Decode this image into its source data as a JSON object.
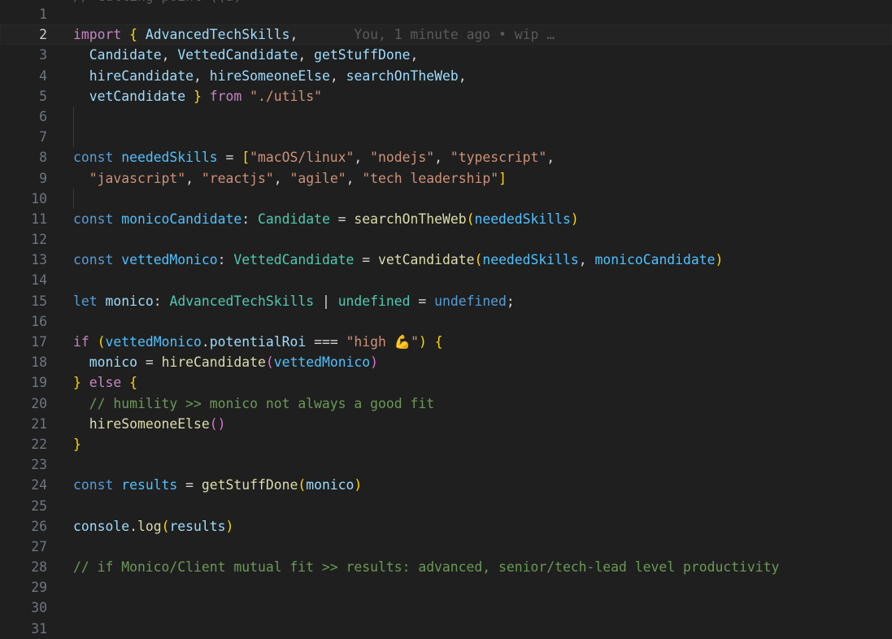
{
  "editor": {
    "top_cutoff_text": "// Cutting point ((a)",
    "blame": "You, 1 minute ago • wip …",
    "lines": [
      {
        "n": "1",
        "tokens": []
      },
      {
        "n": "2",
        "current": true,
        "tokens": [
          [
            "kc",
            "import"
          ],
          [
            "p",
            " "
          ],
          [
            "b1",
            "{"
          ],
          [
            "p",
            " "
          ],
          [
            "v",
            "AdvancedTechSkills"
          ],
          [
            "p",
            ","
          ]
        ],
        "blame": true
      },
      {
        "n": "3",
        "tokens": [
          [
            "p",
            "  "
          ],
          [
            "v",
            "Candidate"
          ],
          [
            "p",
            ", "
          ],
          [
            "v",
            "VettedCandidate"
          ],
          [
            "p",
            ", "
          ],
          [
            "v",
            "getStuffDone"
          ],
          [
            "p",
            ","
          ]
        ]
      },
      {
        "n": "4",
        "tokens": [
          [
            "p",
            "  "
          ],
          [
            "v",
            "hireCandidate"
          ],
          [
            "p",
            ", "
          ],
          [
            "v",
            "hireSomeoneElse"
          ],
          [
            "p",
            ", "
          ],
          [
            "v",
            "searchOnTheWeb"
          ],
          [
            "p",
            ","
          ]
        ]
      },
      {
        "n": "5",
        "tokens": [
          [
            "p",
            "  "
          ],
          [
            "v",
            "vetCandidate"
          ],
          [
            "p",
            " "
          ],
          [
            "b1",
            "}"
          ],
          [
            "p",
            " "
          ],
          [
            "kc",
            "from"
          ],
          [
            "p",
            " "
          ],
          [
            "s",
            "\"./utils\""
          ]
        ]
      },
      {
        "n": "6",
        "tokens": [],
        "guide": true
      },
      {
        "n": "7",
        "tokens": [],
        "guide": true
      },
      {
        "n": "8",
        "tokens": [
          [
            "k",
            "const"
          ],
          [
            "p",
            " "
          ],
          [
            "cv",
            "neededSkills"
          ],
          [
            "p",
            " = "
          ],
          [
            "b1",
            "["
          ],
          [
            "s",
            "\"macOS/linux\""
          ],
          [
            "p",
            ", "
          ],
          [
            "s",
            "\"nodejs\""
          ],
          [
            "p",
            ", "
          ],
          [
            "s",
            "\"typescript\""
          ],
          [
            "p",
            ","
          ]
        ]
      },
      {
        "n": "9",
        "tokens": [
          [
            "p",
            "  "
          ],
          [
            "s",
            "\"javascript\""
          ],
          [
            "p",
            ", "
          ],
          [
            "s",
            "\"reactjs\""
          ],
          [
            "p",
            ", "
          ],
          [
            "s",
            "\"agile\""
          ],
          [
            "p",
            ", "
          ],
          [
            "s",
            "\"tech leadership\""
          ],
          [
            "b1",
            "]"
          ]
        ]
      },
      {
        "n": "10",
        "tokens": [],
        "guide": true
      },
      {
        "n": "11",
        "tokens": [
          [
            "k",
            "const"
          ],
          [
            "p",
            " "
          ],
          [
            "cv",
            "monicoCandidate"
          ],
          [
            "p",
            ": "
          ],
          [
            "t",
            "Candidate"
          ],
          [
            "p",
            " = "
          ],
          [
            "f",
            "searchOnTheWeb"
          ],
          [
            "b1",
            "("
          ],
          [
            "cv",
            "neededSkills"
          ],
          [
            "b1",
            ")"
          ]
        ]
      },
      {
        "n": "12",
        "tokens": []
      },
      {
        "n": "13",
        "tokens": [
          [
            "k",
            "const"
          ],
          [
            "p",
            " "
          ],
          [
            "cv",
            "vettedMonico"
          ],
          [
            "p",
            ": "
          ],
          [
            "t",
            "VettedCandidate"
          ],
          [
            "p",
            " = "
          ],
          [
            "f",
            "vetCandidate"
          ],
          [
            "b1",
            "("
          ],
          [
            "cv",
            "neededSkills"
          ],
          [
            "p",
            ", "
          ],
          [
            "cv",
            "monicoCandidate"
          ],
          [
            "b1",
            ")"
          ]
        ]
      },
      {
        "n": "14",
        "tokens": []
      },
      {
        "n": "15",
        "tokens": [
          [
            "k",
            "let"
          ],
          [
            "p",
            " "
          ],
          [
            "v",
            "monico"
          ],
          [
            "p",
            ": "
          ],
          [
            "t",
            "AdvancedTechSkills"
          ],
          [
            "p",
            " | "
          ],
          [
            "t",
            "undefined"
          ],
          [
            "p",
            " = "
          ],
          [
            "k",
            "undefined"
          ],
          [
            "p",
            ";"
          ]
        ]
      },
      {
        "n": "16",
        "tokens": []
      },
      {
        "n": "17",
        "tokens": [
          [
            "kc",
            "if"
          ],
          [
            "p",
            " "
          ],
          [
            "b1",
            "("
          ],
          [
            "cv",
            "vettedMonico"
          ],
          [
            "p",
            "."
          ],
          [
            "v",
            "potentialRoi"
          ],
          [
            "p",
            " === "
          ],
          [
            "s",
            "\"high 💪\""
          ],
          [
            "b1",
            ")"
          ],
          [
            "p",
            " "
          ],
          [
            "b1",
            "{"
          ]
        ]
      },
      {
        "n": "18",
        "tokens": [
          [
            "p",
            "  "
          ],
          [
            "v",
            "monico"
          ],
          [
            "p",
            " = "
          ],
          [
            "f",
            "hireCandidate"
          ],
          [
            "b2",
            "("
          ],
          [
            "cv",
            "vettedMonico"
          ],
          [
            "b2",
            ")"
          ]
        ]
      },
      {
        "n": "19",
        "tokens": [
          [
            "b1",
            "}"
          ],
          [
            "p",
            " "
          ],
          [
            "kc",
            "else"
          ],
          [
            "p",
            " "
          ],
          [
            "b1",
            "{"
          ]
        ]
      },
      {
        "n": "20",
        "tokens": [
          [
            "p",
            "  "
          ],
          [
            "c",
            "// humility >> monico not always a good fit"
          ]
        ]
      },
      {
        "n": "21",
        "tokens": [
          [
            "p",
            "  "
          ],
          [
            "f",
            "hireSomeoneElse"
          ],
          [
            "b2",
            "()"
          ]
        ]
      },
      {
        "n": "22",
        "tokens": [
          [
            "b1",
            "}"
          ]
        ]
      },
      {
        "n": "23",
        "tokens": []
      },
      {
        "n": "24",
        "tokens": [
          [
            "k",
            "const"
          ],
          [
            "p",
            " "
          ],
          [
            "cv",
            "results"
          ],
          [
            "p",
            " = "
          ],
          [
            "f",
            "getStuffDone"
          ],
          [
            "b1",
            "("
          ],
          [
            "v",
            "monico"
          ],
          [
            "b1",
            ")"
          ]
        ]
      },
      {
        "n": "25",
        "tokens": []
      },
      {
        "n": "26",
        "tokens": [
          [
            "v",
            "console"
          ],
          [
            "p",
            "."
          ],
          [
            "f",
            "log"
          ],
          [
            "b1",
            "("
          ],
          [
            "v",
            "results"
          ],
          [
            "b1",
            ")"
          ]
        ]
      },
      {
        "n": "27",
        "tokens": []
      },
      {
        "n": "28",
        "tokens": [
          [
            "c",
            "// if Monico/Client mutual fit >> results: advanced, senior/tech-lead level productivity"
          ]
        ]
      },
      {
        "n": "29",
        "tokens": []
      },
      {
        "n": "30",
        "tokens": []
      },
      {
        "n": "31",
        "tokens": []
      }
    ]
  }
}
